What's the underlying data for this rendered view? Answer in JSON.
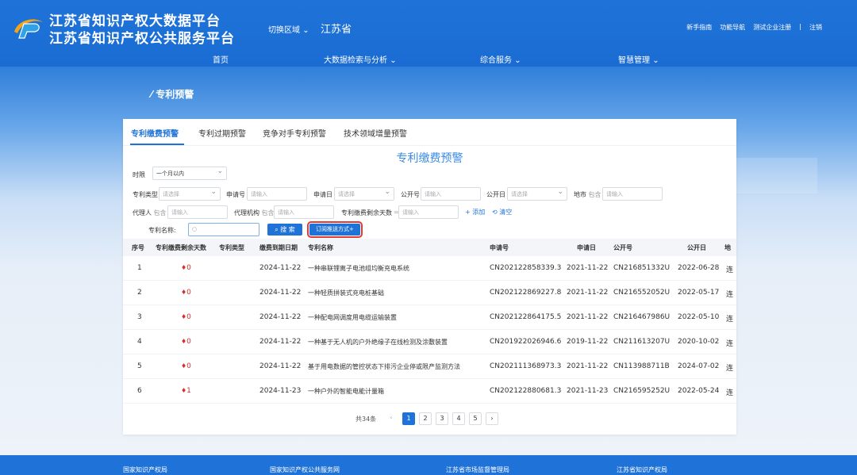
{
  "header": {
    "title_line1": "江苏省知识产权大数据平台",
    "title_line2": "江苏省知识产权公共服务平台",
    "region_switch": "切换区域",
    "region_name": "江苏省",
    "links": [
      "新手指南",
      "功能导航",
      "测试企业注册",
      "注销"
    ]
  },
  "nav": [
    "首页",
    "大数据检索与分析",
    "综合服务",
    "智慧管理"
  ],
  "page_title": "专利预警",
  "tabs": [
    "专利缴费预警",
    "专利过期预警",
    "竞争对手专利预警",
    "技术领域增量预警"
  ],
  "panel_title": "专利缴费预警",
  "filters": {
    "time_label": "时限",
    "time_value": "一个月以内",
    "patent_type_label": "专利类型",
    "please_select": "请选择",
    "please_input": "请输入",
    "contains": "包含",
    "app_no_label": "申请号",
    "app_date_label": "申请日",
    "pub_no_label": "公开号",
    "pub_date_label": "公开日",
    "address_label": "地市",
    "agent_person_label": "代理人",
    "agency_label": "代理机构",
    "fee_days_label": "专利缴费剩余天数",
    "add_label": "+ 添加",
    "clear_label": "清空",
    "name_label": "专利名称:",
    "search_label": "搜 索",
    "subscribe_label": "订阅推送方式+"
  },
  "table": {
    "headers": [
      "序号",
      "专利缴费剩余天数",
      "专利类型",
      "缴费到期日期",
      "专利名称",
      "申请号",
      "申请日",
      "公开号",
      "公开日",
      "地"
    ],
    "rows": [
      {
        "no": "1",
        "days": "0",
        "type": "",
        "due": "2024-11-22",
        "name": "一种串联锂离子电池组均衡充电系统",
        "app_no": "CN202122858339.3",
        "app_date": "2021-11-22",
        "pub_no": "CN216851332U",
        "pub_date": "2022-06-28",
        "addr": "连"
      },
      {
        "no": "2",
        "days": "0",
        "type": "",
        "due": "2024-11-22",
        "name": "一种轻质拼装式充电桩基础",
        "app_no": "CN202122869227.8",
        "app_date": "2021-11-22",
        "pub_no": "CN216552052U",
        "pub_date": "2022-05-17",
        "addr": "连"
      },
      {
        "no": "3",
        "days": "0",
        "type": "",
        "due": "2024-11-22",
        "name": "一种配电网调度用电缆运输装置",
        "app_no": "CN202122864175.5",
        "app_date": "2021-11-22",
        "pub_no": "CN216467986U",
        "pub_date": "2022-05-10",
        "addr": "连"
      },
      {
        "no": "4",
        "days": "0",
        "type": "",
        "due": "2024-11-22",
        "name": "一种基于无人机的户外绝缘子在线检测及涂敷装置",
        "app_no": "CN201922026946.6",
        "app_date": "2019-11-22",
        "pub_no": "CN211613207U",
        "pub_date": "2020-10-02",
        "addr": "连"
      },
      {
        "no": "5",
        "days": "0",
        "type": "",
        "due": "2024-11-22",
        "name": "基于用电数据的管控状态下排污企业停或限产监测方法",
        "app_no": "CN202111368973.3",
        "app_date": "2021-11-22",
        "pub_no": "CN113988711B",
        "pub_date": "2024-07-02",
        "addr": "连"
      },
      {
        "no": "6",
        "days": "1",
        "type": "",
        "due": "2024-11-23",
        "name": "一种户外的智能电能计量箱",
        "app_no": "CN202122880681.3",
        "app_date": "2021-11-23",
        "pub_no": "CN216595252U",
        "pub_date": "2022-05-24",
        "addr": "连"
      }
    ]
  },
  "pager": {
    "total": "共34条",
    "prev": "‹",
    "next": "›",
    "pages": [
      "1",
      "2",
      "3",
      "4",
      "5"
    ],
    "current": "1"
  },
  "footer": [
    "国家知识产权局",
    "国家知识产权公共服务网",
    "江苏省市场监督管理局",
    "江苏省知识产权局"
  ],
  "colors": {
    "primary": "#1f73d8",
    "warning": "#d32f2f",
    "highlight_border": "#e53935"
  }
}
